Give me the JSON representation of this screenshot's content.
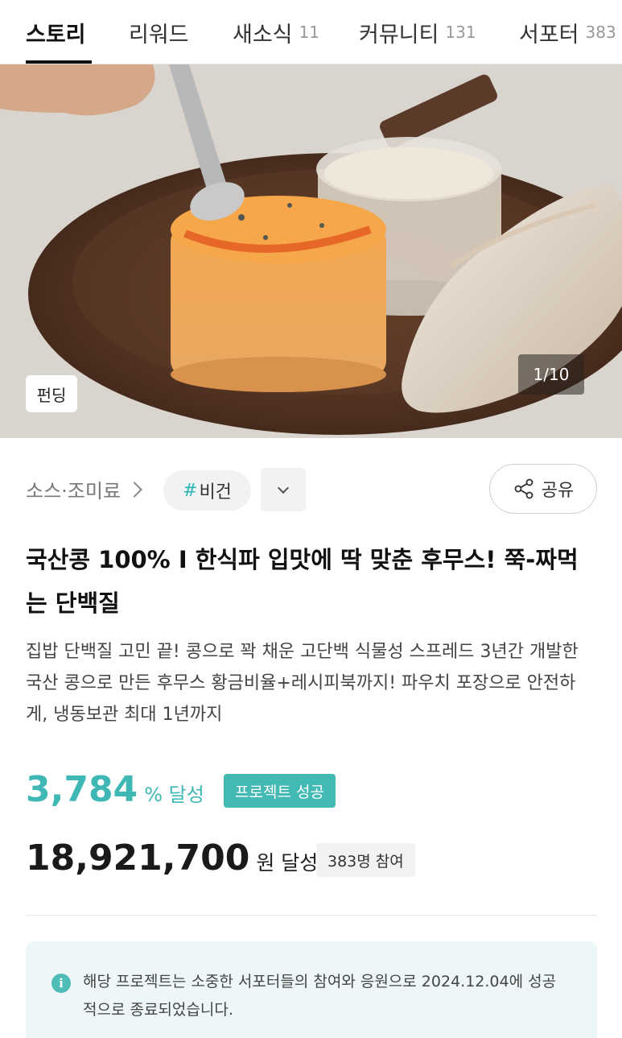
{
  "tabs": [
    {
      "label": "스토리",
      "count": ""
    },
    {
      "label": "리워드",
      "count": ""
    },
    {
      "label": "새소식",
      "count": "11"
    },
    {
      "label": "커뮤니티",
      "count": "131"
    },
    {
      "label": "서포터",
      "count": "383"
    }
  ],
  "hero": {
    "badge": "펀딩",
    "page_counter": "1/10"
  },
  "category": {
    "label": "소스·조미료",
    "tag_hash": "#",
    "tag": "비건",
    "share_label": "공유"
  },
  "project": {
    "title": "국산콩 100% I 한식파 입맛에 딱 맞춘 후무스! 쭉-짜먹는 단백질",
    "description": "집밥 단백질 고민 끝! 콩으로 꽉 채운 고단백 식물성 스프레드 3년간 개발한 국산 콩으로 만든 후무스 황금비율+레시피북까지! 파우치 포장으로 안전하게, 냉동보관 최대 1년까지"
  },
  "stats": {
    "percent": "3,784",
    "percent_unit": "% 달성",
    "status_badge": "프로젝트 성공",
    "amount": "18,921,700",
    "amount_unit": "원 달성",
    "supporters": "383명 참여"
  },
  "notice": {
    "text": "해당 프로젝트는 소중한 서포터들의 참여와 응원으로 2024.12.04에 성공적으로 종료되었습니다."
  },
  "colors": {
    "accent": "#3fb8b5",
    "success_badge": "#43b9b4",
    "notice_bg": "#eef7f7"
  }
}
